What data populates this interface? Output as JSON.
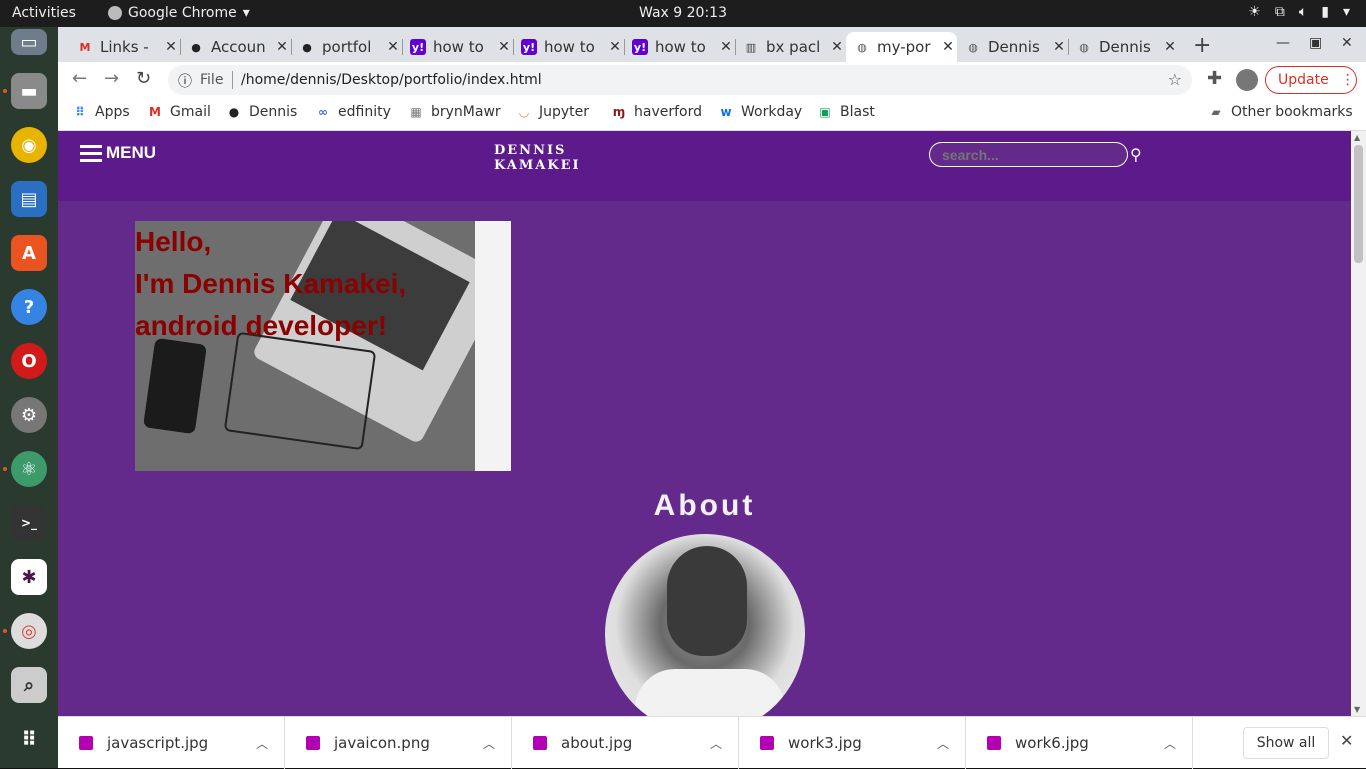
{
  "system": {
    "activities": "Activities",
    "app_name": "Google Chrome",
    "clock": "Wax 9  20:13"
  },
  "browser": {
    "tabs": [
      {
        "label": "Links -",
        "icon": "gmail-icon",
        "active": false
      },
      {
        "label": "Accoun",
        "icon": "github-icon",
        "active": false
      },
      {
        "label": "portfol",
        "icon": "github-icon",
        "active": false
      },
      {
        "label": "how to",
        "icon": "yahoo-icon",
        "active": false
      },
      {
        "label": "how to",
        "icon": "yahoo-icon",
        "active": false
      },
      {
        "label": "how to",
        "icon": "yahoo-icon",
        "active": false
      },
      {
        "label": "bx pacl",
        "icon": "page-icon",
        "active": false
      },
      {
        "label": "my-por",
        "icon": "globe-icon",
        "active": true
      },
      {
        "label": "Dennis",
        "icon": "globe-icon",
        "active": false
      },
      {
        "label": "Dennis",
        "icon": "globe-icon",
        "active": false
      }
    ],
    "address": {
      "scheme_label": "File",
      "url": "/home/dennis/Desktop/portfolio/index.html"
    },
    "update_label": "Update",
    "bookmarks": [
      {
        "label": "Apps",
        "icon": "apps-grid-icon"
      },
      {
        "label": "Gmail",
        "icon": "gmail-icon"
      },
      {
        "label": "Dennis",
        "icon": "github-icon"
      },
      {
        "label": "edfinity",
        "icon": "edfinity-icon"
      },
      {
        "label": "brynMawr",
        "icon": "college-icon"
      },
      {
        "label": "Jupyter",
        "icon": "jupyter-icon"
      },
      {
        "label": "haverford",
        "icon": "haverford-icon"
      },
      {
        "label": "Workday",
        "icon": "workday-icon"
      },
      {
        "label": "Blast",
        "icon": "blast-icon"
      }
    ],
    "other_bookmarks": "Other bookmarks"
  },
  "site": {
    "menu_label": "MENU",
    "brand_line1": "DENNIS",
    "brand_line2": "KAMAKEI",
    "search_placeholder": "search...",
    "hero_line1": "Hello,",
    "hero_line2": "I'm Dennis Kamakei,",
    "hero_line3": "android developer!",
    "about_title": "About"
  },
  "downloads": {
    "items": [
      {
        "name": "javascript.jpg"
      },
      {
        "name": "javaicon.png"
      },
      {
        "name": "about.jpg"
      },
      {
        "name": "work3.jpg"
      },
      {
        "name": "work6.jpg"
      }
    ],
    "show_all": "Show all"
  },
  "colors": {
    "page_bg": "#632a8c",
    "header_bg": "#5c1a8a",
    "hero_text": "#8b0000",
    "update_red": "#d93025"
  }
}
